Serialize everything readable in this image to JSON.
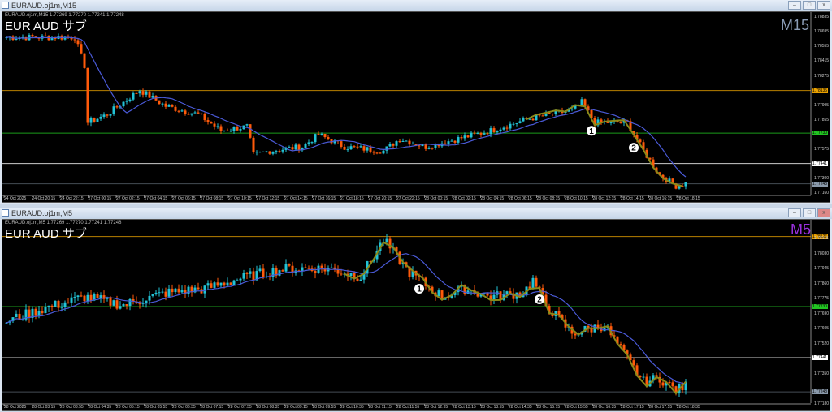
{
  "windows": [
    {
      "title": "EURAUD.oj1m,M15",
      "header": "EURAUD.oj1m,M15  1.77269 1.77270 1.77241 1.77248",
      "symbol_label": "EUR AUD サブ",
      "timeframe": "M15",
      "timeframe_color": "#8a9bb5",
      "price_ticks": [
        "1.78835",
        "1.78695",
        "1.78555",
        "1.78415",
        "1.78275",
        "1.77995",
        "1.77855",
        "1.77575",
        "1.77300",
        "1.77160"
      ],
      "levels": [
        {
          "price": "1.78135",
          "color": "#e8a000"
        },
        {
          "price": "1.77730",
          "color": "#22c422"
        },
        {
          "price": "1.77441",
          "color": "#ffffff"
        },
        {
          "price": "1.77248",
          "color": "#8a99aa"
        }
      ],
      "time_ticks": [
        "24 Oct 2025",
        "24 Oct 20:15",
        "24 Oct 22:15",
        "27 Oct 00:15",
        "27 Oct 02:15",
        "27 Oct 04:15",
        "27 Oct 06:15",
        "27 Oct 08:15",
        "27 Oct 10:15",
        "27 Oct 12:15",
        "27 Oct 14:15",
        "27 Oct 16:15",
        "27 Oct 18:15",
        "27 Oct 20:15",
        "27 Oct 22:15",
        "28 Oct 00:15",
        "28 Oct 02:15",
        "28 Oct 04:15",
        "28 Oct 06:15",
        "28 Oct 08:15",
        "28 Oct 10:15",
        "28 Oct 12:15",
        "28 Oct 14:15",
        "28 Oct 16:15",
        "28 Oct 18:15"
      ],
      "price_path": [
        [
          0,
          1.78642
        ],
        [
          21,
          1.78642
        ],
        [
          24,
          1.78372
        ],
        [
          25,
          1.77831
        ],
        [
          31,
          1.77909
        ],
        [
          41,
          1.7814
        ],
        [
          49,
          1.77986
        ],
        [
          59,
          1.77909
        ],
        [
          66,
          1.77754
        ],
        [
          74,
          1.77793
        ],
        [
          76,
          1.77523
        ],
        [
          81,
          1.77561
        ],
        [
          91,
          1.776
        ],
        [
          96,
          1.77716
        ],
        [
          104,
          1.776
        ],
        [
          116,
          1.77561
        ],
        [
          121,
          1.77677
        ],
        [
          129,
          1.776
        ],
        [
          139,
          1.77677
        ],
        [
          149,
          1.77754
        ],
        [
          161,
          1.7787
        ],
        [
          174,
          1.77947
        ],
        [
          177,
          1.78024
        ],
        [
          181,
          1.77831
        ],
        [
          191,
          1.77831
        ],
        [
          196,
          1.77561
        ],
        [
          201,
          1.7733
        ],
        [
          206,
          1.77229
        ],
        [
          209,
          1.77252
        ]
      ],
      "markers": [
        {
          "label": "1",
          "bar": 180
        },
        {
          "label": "2",
          "bar": 193
        }
      ]
    },
    {
      "title": "EURAUD.oj1m,M5",
      "header": "EURAUD.oj1m,M5  1.77269 1.77270 1.77241 1.77248",
      "symbol_label": "EUR AUD サブ",
      "timeframe": "M5",
      "timeframe_color": "#9b30e0",
      "price_ticks": [
        "1.78115",
        "1.78030",
        "1.77945",
        "1.77860",
        "1.77775",
        "1.77690",
        "1.77605",
        "1.77520",
        "1.77350",
        "1.77180"
      ],
      "levels": [
        {
          "price": "1.78126",
          "color": "#e8a000"
        },
        {
          "price": "1.77730",
          "color": "#22c422"
        },
        {
          "price": "1.77441",
          "color": "#ffffff"
        },
        {
          "price": "1.77248",
          "color": "#8a99aa"
        }
      ],
      "time_ticks": [
        "28 Oct 2025",
        "28 Oct 03:15",
        "28 Oct 03:55",
        "28 Oct 04:35",
        "28 Oct 05:15",
        "28 Oct 05:55",
        "28 Oct 06:35",
        "28 Oct 07:15",
        "28 Oct 07:55",
        "28 Oct 08:35",
        "28 Oct 09:15",
        "28 Oct 09:55",
        "28 Oct 10:35",
        "28 Oct 11:15",
        "28 Oct 11:55",
        "28 Oct 12:35",
        "28 Oct 13:15",
        "28 Oct 13:55",
        "28 Oct 14:35",
        "28 Oct 15:15",
        "28 Oct 15:55",
        "28 Oct 16:35",
        "28 Oct 17:15",
        "28 Oct 17:55",
        "28 Oct 18:35"
      ],
      "price_path": [
        [
          0,
          1.77648
        ],
        [
          11,
          1.77716
        ],
        [
          24,
          1.77785
        ],
        [
          36,
          1.77739
        ],
        [
          49,
          1.77808
        ],
        [
          61,
          1.77831
        ],
        [
          74,
          1.779
        ],
        [
          86,
          1.77945
        ],
        [
          99,
          1.77945
        ],
        [
          109,
          1.779
        ],
        [
          116,
          1.78106
        ],
        [
          121,
          1.77991
        ],
        [
          124,
          1.77923
        ],
        [
          134,
          1.77785
        ],
        [
          141,
          1.77831
        ],
        [
          149,
          1.77785
        ],
        [
          159,
          1.77808
        ],
        [
          162,
          1.77877
        ],
        [
          166,
          1.77739
        ],
        [
          174,
          1.77579
        ],
        [
          184,
          1.77625
        ],
        [
          189,
          1.77487
        ],
        [
          196,
          1.77304
        ],
        [
          201,
          1.77327
        ],
        [
          206,
          1.77258
        ],
        [
          209,
          1.77281
        ]
      ],
      "markers": [
        {
          "label": "1",
          "bar": 127
        },
        {
          "label": "2",
          "bar": 164
        }
      ]
    }
  ],
  "colors": {
    "bull": "#22c3d6",
    "bear": "#ff5a0a",
    "ma": "#4a5ad8",
    "zigzag": "#8a8a1a"
  }
}
